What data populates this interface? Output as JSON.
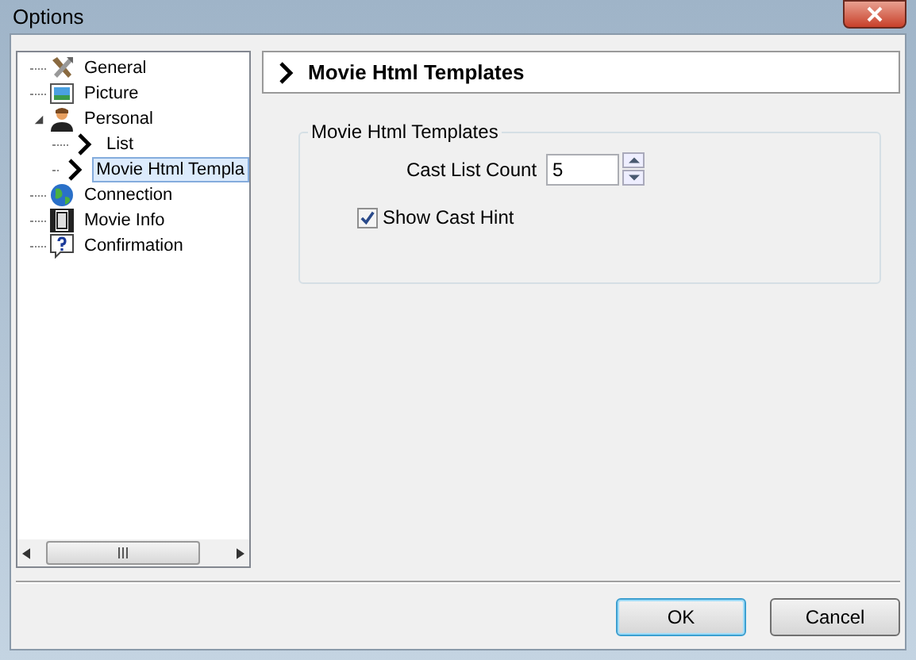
{
  "window": {
    "title": "Options"
  },
  "tree": {
    "items": [
      {
        "label": "General",
        "kind": "tools",
        "selected": false
      },
      {
        "label": "Picture",
        "kind": "picture",
        "selected": false
      },
      {
        "label": "Personal",
        "kind": "person",
        "selected": false,
        "expanded": true,
        "children": [
          {
            "label": "List",
            "kind": "chevron",
            "selected": false
          },
          {
            "label": "Movie Html Templa",
            "kind": "chevron",
            "selected": true
          }
        ]
      },
      {
        "label": "Connection",
        "kind": "globe",
        "selected": false
      },
      {
        "label": "Movie Info",
        "kind": "film",
        "selected": false
      },
      {
        "label": "Confirmation",
        "kind": "question",
        "selected": false
      }
    ]
  },
  "page_header": {
    "title": "Movie Html Templates"
  },
  "group": {
    "title": "Movie Html Templates",
    "cast_list_count": {
      "label": "Cast List Count",
      "value": "5"
    },
    "show_cast_hint": {
      "label": "Show Cast Hint",
      "checked": true
    }
  },
  "buttons": [
    {
      "label": "OK",
      "default": true
    },
    {
      "label": "Cancel",
      "default": false
    }
  ]
}
